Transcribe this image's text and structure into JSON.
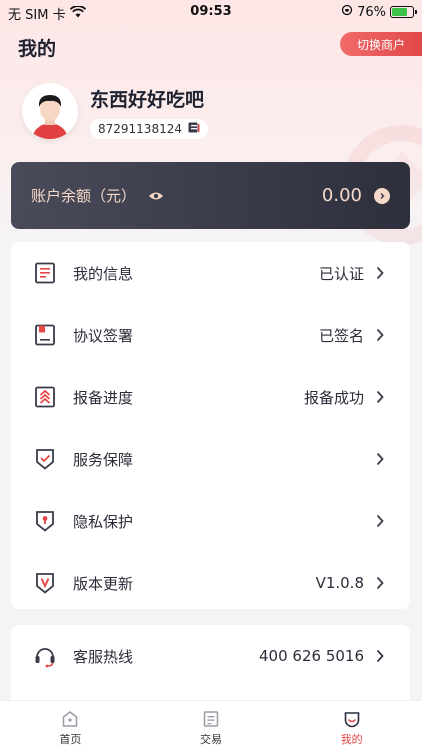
{
  "status_bar": {
    "carrier": "无 SIM 卡",
    "time": "09:53",
    "battery": "76%"
  },
  "header": {
    "title": "我的",
    "switch_label": "切换商户"
  },
  "profile": {
    "name": "东西好好吃吧",
    "id": "87291138124"
  },
  "balance": {
    "label": "账户余额（元）",
    "amount": "0.00"
  },
  "menu": [
    {
      "label": "我的信息",
      "value": "已认证",
      "icon": "document-icon"
    },
    {
      "label": "协议签署",
      "value": "已签名",
      "icon": "agreement-icon"
    },
    {
      "label": "报备进度",
      "value": "报备成功",
      "icon": "progress-icon"
    },
    {
      "label": "服务保障",
      "value": "",
      "icon": "shield-check-icon"
    },
    {
      "label": "隐私保护",
      "value": "",
      "icon": "privacy-lock-icon"
    },
    {
      "label": "版本更新",
      "value": "V1.0.8",
      "icon": "version-icon"
    }
  ],
  "hotline": {
    "label": "客服热线",
    "value": "400 626 5016"
  },
  "tabs": [
    {
      "label": "首页",
      "icon": "home-icon"
    },
    {
      "label": "交易",
      "icon": "transaction-icon"
    },
    {
      "label": "我的",
      "icon": "mine-icon",
      "active": true
    }
  ],
  "colors": {
    "accent": "#e64848",
    "card_dark": "#3a3b48",
    "balance_text": "#f6d9c8"
  }
}
